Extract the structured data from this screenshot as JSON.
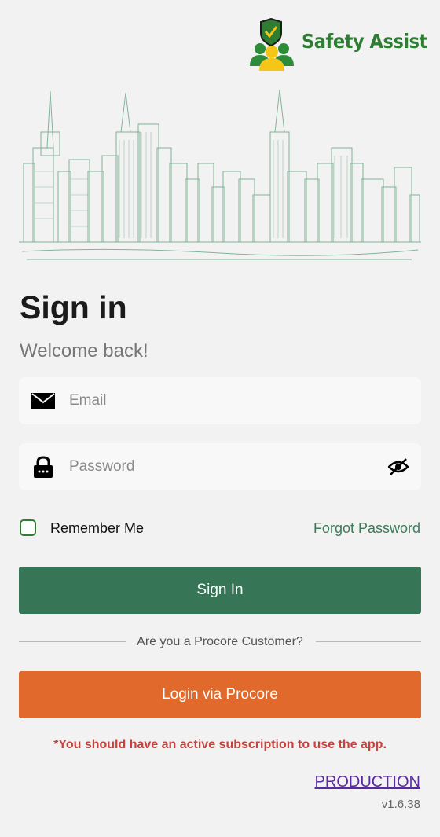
{
  "brand": {
    "name": "Safety Assist",
    "accent": "#2e7d32",
    "icon": "shield-people-logo"
  },
  "header": {
    "title": "Sign in",
    "subtitle": "Welcome back!"
  },
  "form": {
    "email": {
      "icon": "mail-icon",
      "placeholder": "Email",
      "value": ""
    },
    "password": {
      "icon": "lock-icon",
      "placeholder": "Password",
      "value": "",
      "toggle_icon": "eye-off-icon"
    },
    "remember_me": {
      "label": "Remember Me",
      "checked": false
    },
    "forgot_password": "Forgot Password",
    "sign_in_label": "Sign In"
  },
  "procore": {
    "divider_text": "Are you a Procore Customer?",
    "button_label": "Login via Procore",
    "button_color": "#e0692b"
  },
  "notice": "*You should have an active subscription to use the app.",
  "environment": "PRODUCTION",
  "version": "v1.6.38",
  "colors": {
    "primary": "#367556",
    "background": "#f2f2f2",
    "notice": "#c8413e"
  }
}
